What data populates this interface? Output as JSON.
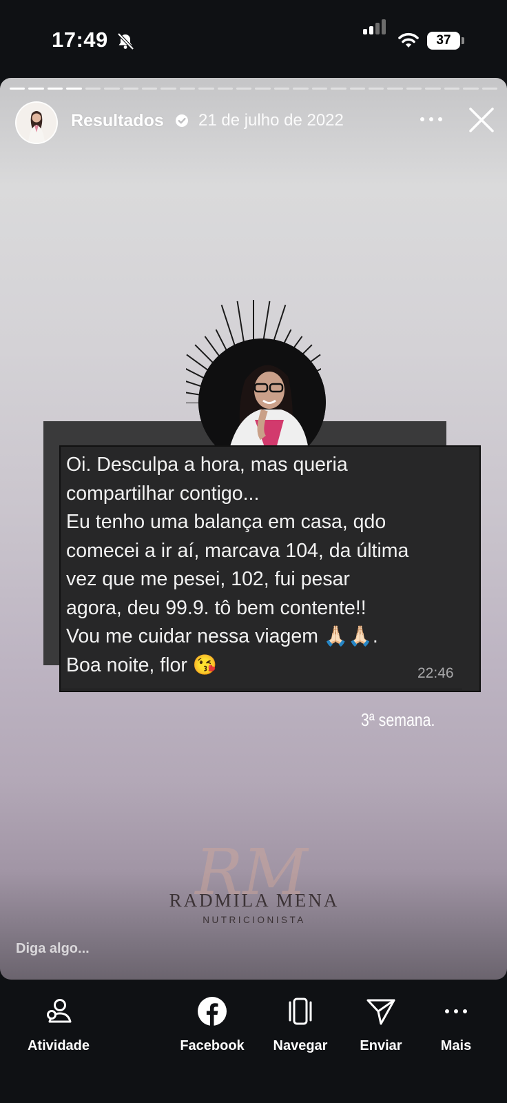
{
  "status_bar": {
    "time": "17:49",
    "battery": "37"
  },
  "story": {
    "author": "Resultados",
    "date": "21 de julho de 2022",
    "segments_total": 26,
    "segments_done": 4
  },
  "message": {
    "lines": [
      "Oi. Desculpa a hora, mas queria",
      "compartilhar contigo...",
      "Eu tenho uma balança em casa, qdo",
      "comecei a ir aí, marcava 104, da última",
      "vez que me pesei, 102, fui pesar",
      "agora, deu 99.9. tô bem contente!!",
      "Vou me cuidar nessa viagem 🙏🏻🙏🏻.",
      "Boa noite, flor 😘"
    ],
    "time": "22:46"
  },
  "caption": "3ª semana.",
  "logo": {
    "monogram": "RM",
    "name": "RADMILA MENA",
    "subtitle": "NUTRICIONISTA"
  },
  "reply_placeholder": "Diga algo...",
  "bottom_tabs": [
    {
      "label": "Atividade",
      "icon": "activity-icon"
    },
    {
      "label": "Facebook",
      "icon": "facebook-icon"
    },
    {
      "label": "Navegar",
      "icon": "navigate-icon"
    },
    {
      "label": "Enviar",
      "icon": "send-icon"
    },
    {
      "label": "Mais",
      "icon": "more-icon"
    }
  ],
  "colors": {
    "card": "#272728",
    "accent_orange": "#a45a22",
    "background": "#0f1114"
  }
}
